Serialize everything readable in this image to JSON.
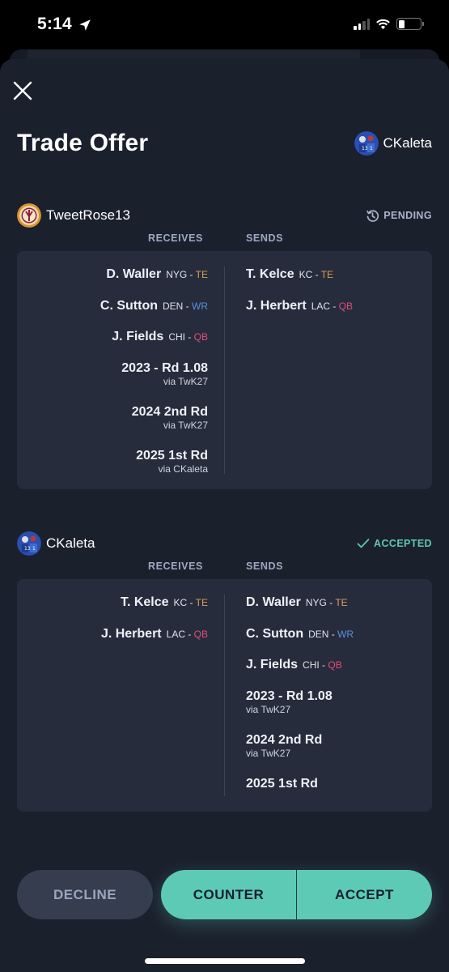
{
  "status_bar": {
    "time": "5:14",
    "location_icon": "location-arrow-icon",
    "signal_icon": "cellular-signal-icon",
    "wifi_icon": "wifi-icon",
    "battery_icon": "battery-icon"
  },
  "header": {
    "close_icon": "close-icon",
    "title": "Trade Offer",
    "current_user": "CKaleta"
  },
  "parties": [
    {
      "user": "TweetRose13",
      "status": "PENDING",
      "status_icon": "clock-history-icon",
      "receives_label": "RECEIVES",
      "sends_label": "SENDS",
      "receives": [
        {
          "name": "D. Waller",
          "team": "NYG",
          "sep": " - ",
          "pos": "TE"
        },
        {
          "name": "C. Sutton",
          "team": "DEN",
          "sep": " - ",
          "pos": "WR"
        },
        {
          "name": "J. Fields",
          "team": "CHI",
          "sep": " - ",
          "pos": "QB"
        },
        {
          "name": "2023 - Rd 1.08",
          "sub": "via TwK27"
        },
        {
          "name": "2024 2nd Rd",
          "sub": "via TwK27"
        },
        {
          "name": "2025 1st Rd",
          "sub": "via CKaleta"
        }
      ],
      "sends": [
        {
          "name": "T. Kelce",
          "team": "KC",
          "sep": " - ",
          "pos": "TE"
        },
        {
          "name": "J. Herbert",
          "team": "LAC",
          "sep": " - ",
          "pos": "QB"
        }
      ]
    },
    {
      "user": "CKaleta",
      "status": "ACCEPTED",
      "status_icon": "checkmark-icon",
      "receives_label": "RECEIVES",
      "sends_label": "SENDS",
      "receives": [
        {
          "name": "T. Kelce",
          "team": "KC",
          "sep": " - ",
          "pos": "TE"
        },
        {
          "name": "J. Herbert",
          "team": "LAC",
          "sep": " - ",
          "pos": "QB"
        }
      ],
      "sends": [
        {
          "name": "D. Waller",
          "team": "NYG",
          "sep": " - ",
          "pos": "TE"
        },
        {
          "name": "C. Sutton",
          "team": "DEN",
          "sep": " - ",
          "pos": "WR"
        },
        {
          "name": "J. Fields",
          "team": "CHI",
          "sep": " - ",
          "pos": "QB"
        },
        {
          "name": "2023 - Rd 1.08",
          "sub": "via TwK27"
        },
        {
          "name": "2024 2nd Rd",
          "sub": "via TwK27"
        },
        {
          "name": "2025 1st Rd"
        }
      ]
    }
  ],
  "actions": {
    "decline": "DECLINE",
    "counter": "COUNTER",
    "accept": "ACCEPT"
  },
  "colors": {
    "accent": "#5ccab5",
    "position_te": "#d99d5f",
    "position_wr": "#5b8fe0",
    "position_qb": "#df4f7a",
    "background": "#1b202d",
    "card": "#262c3b"
  }
}
